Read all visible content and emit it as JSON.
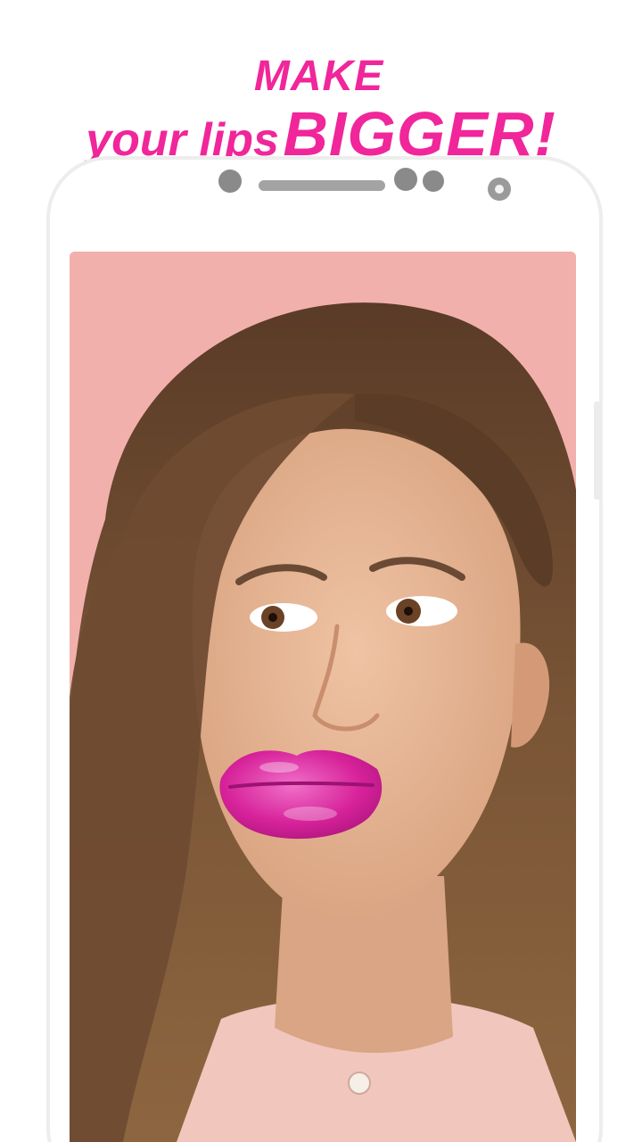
{
  "headline": {
    "line1": "MAKE",
    "line2_prefix": "your lips",
    "line2_emphasis": "BIGGER!"
  },
  "colors": {
    "accent": "#f0269a",
    "photo_background": "#f2b0ad",
    "lips": "#d7229a",
    "hair": "#6b4a32",
    "skin": "#e4b090",
    "shirt": "#f1c6bd"
  },
  "icons": {
    "front_camera": "front-camera-icon",
    "speaker": "speaker-grille-icon",
    "sensor": "proximity-sensor-icon"
  }
}
